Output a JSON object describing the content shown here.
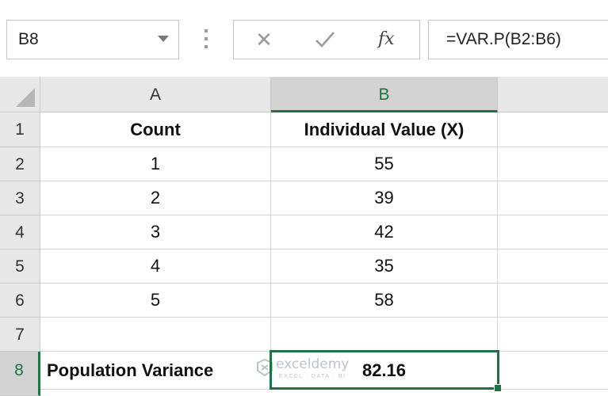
{
  "formula_bar": {
    "name_box": "B8",
    "cancel_symbol": "✕",
    "fx_label": "fx",
    "formula": "=VAR.P(B2:B6)"
  },
  "columns": [
    "A",
    "B"
  ],
  "rows": [
    "1",
    "2",
    "3",
    "4",
    "5",
    "6",
    "7",
    "8"
  ],
  "table": {
    "header": {
      "count": "Count",
      "value": "Individual Value (X)"
    },
    "data": [
      {
        "count": "1",
        "value": "55"
      },
      {
        "count": "2",
        "value": "39"
      },
      {
        "count": "3",
        "value": "42"
      },
      {
        "count": "4",
        "value": "35"
      },
      {
        "count": "5",
        "value": "58"
      }
    ],
    "row7": {
      "a": "",
      "b": ""
    },
    "result": {
      "label": "Population Variance",
      "value": "82.16"
    }
  },
  "watermark": {
    "brand": "exceldemy",
    "tagline": "EXCEL · DATA · BI"
  },
  "colors": {
    "accent": "#217346",
    "header_bg": "#e8e8e8",
    "gridline": "#d4d4d4"
  }
}
